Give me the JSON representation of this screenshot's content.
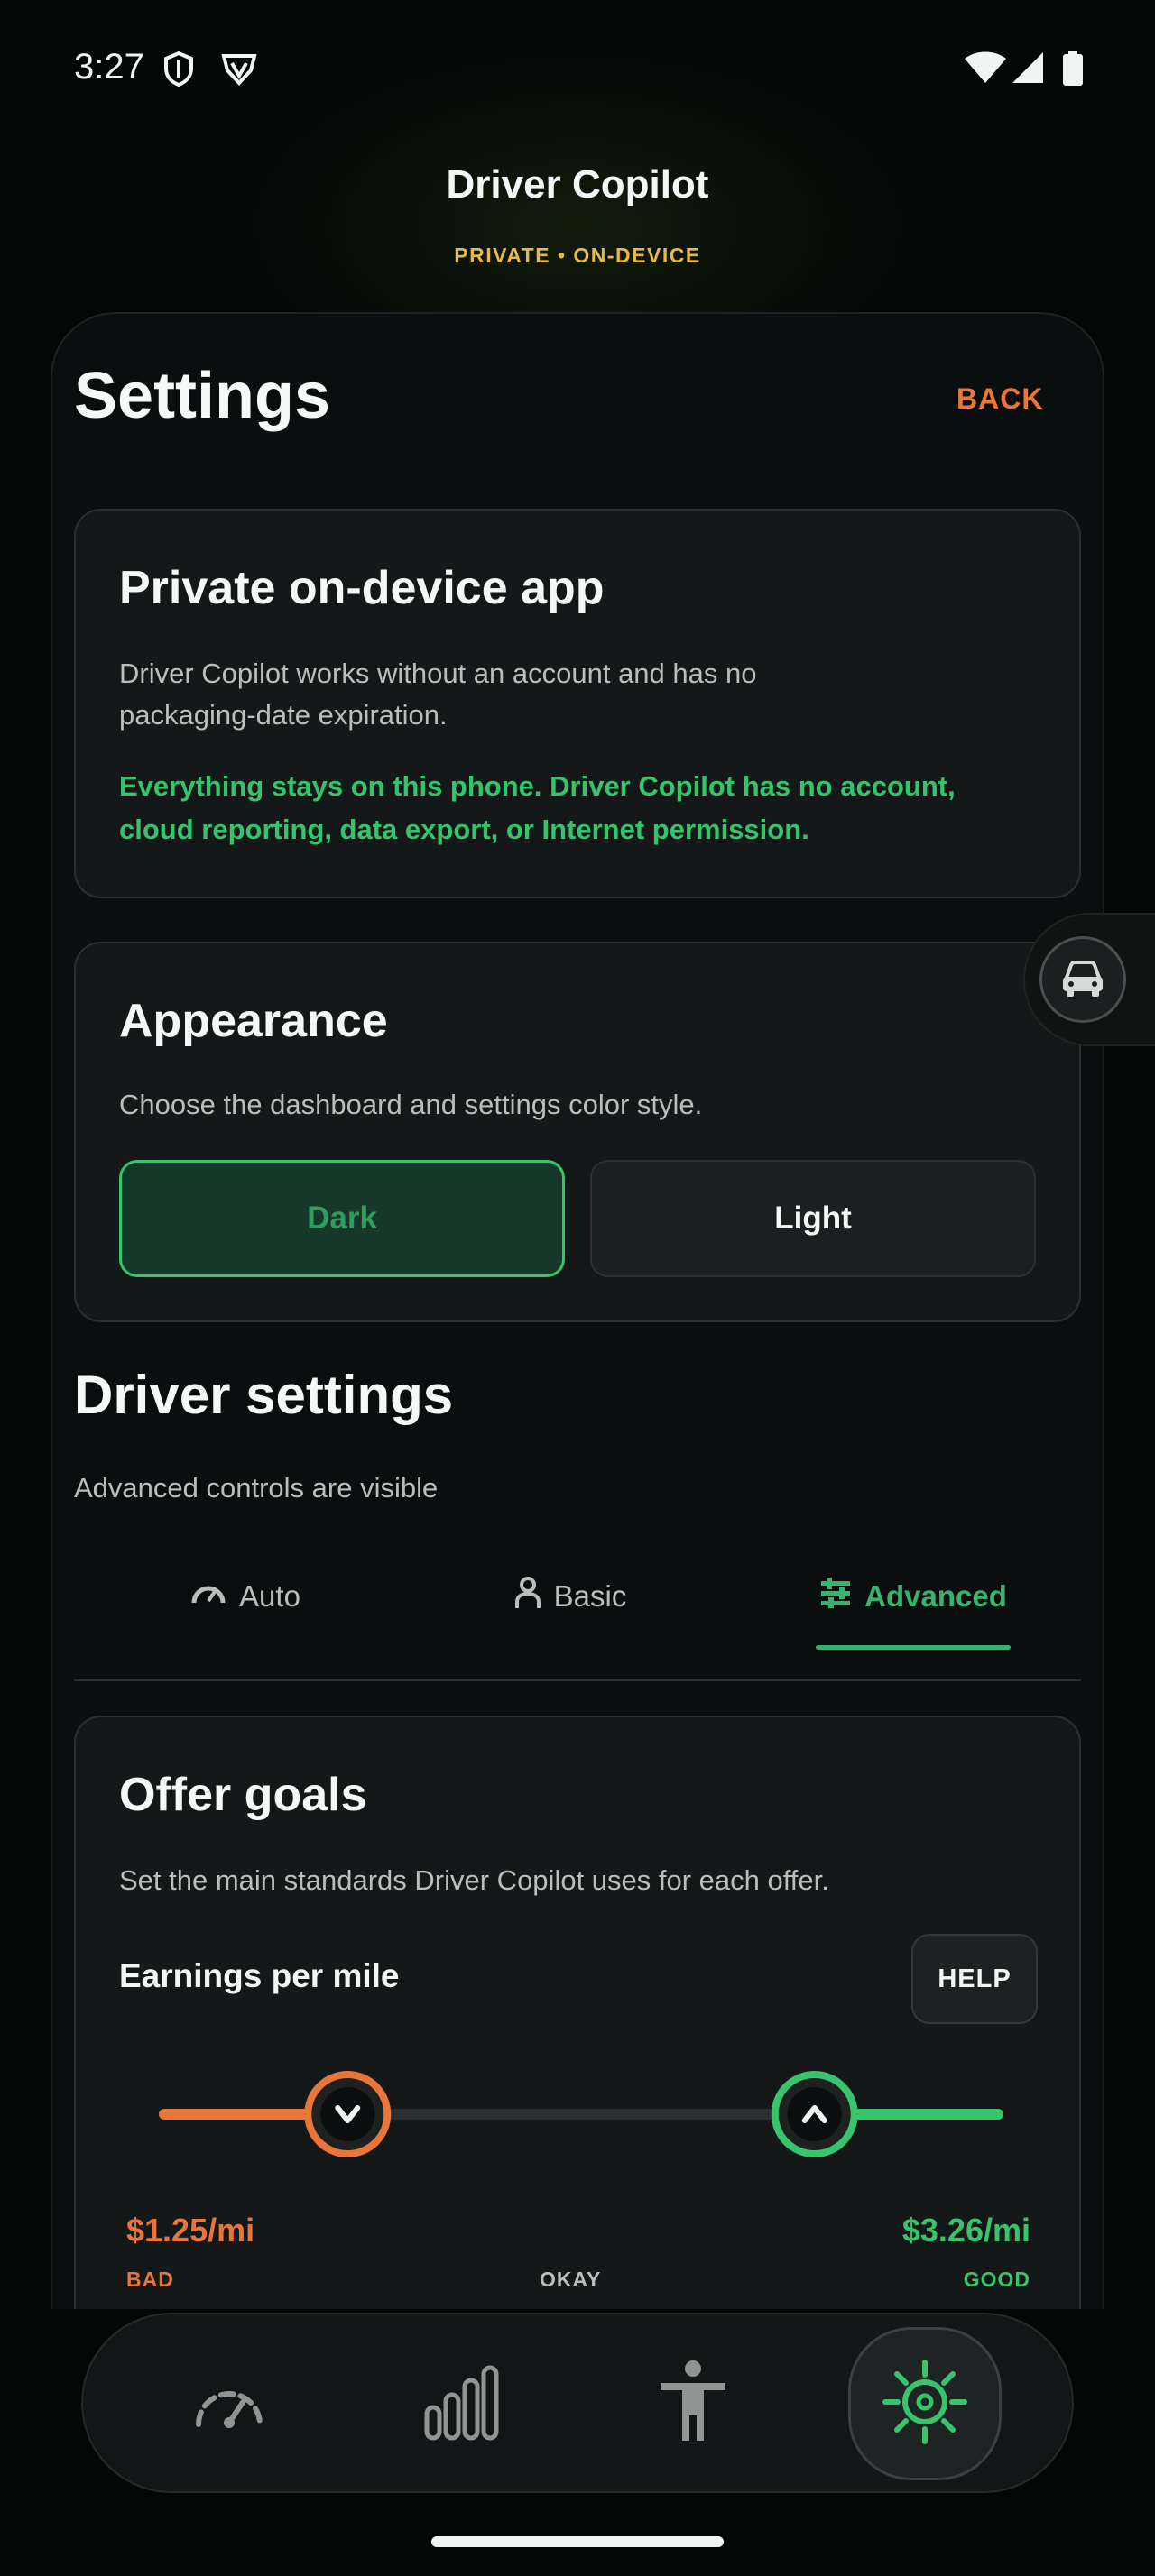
{
  "status_bar": {
    "time": "3:27",
    "left_icons": [
      "shield-icon",
      "vpn-icon"
    ],
    "right_icons": [
      "wifi-icon",
      "signal-icon",
      "battery-icon"
    ]
  },
  "header": {
    "title": "Driver Copilot",
    "subtitle": "PRIVATE • ON-DEVICE"
  },
  "page": {
    "title": "Settings",
    "back_label": "BACK"
  },
  "privacy_card": {
    "title": "Private on-device app",
    "line1": "Driver Copilot works without an account and has no",
    "line2": "packaging-date expiration.",
    "highlight1": "Everything stays on this phone. Driver Copilot has no account,",
    "highlight2": "cloud reporting, data export, or Internet permission."
  },
  "appearance_card": {
    "title": "Appearance",
    "description": "Choose the dashboard and settings color style.",
    "options": [
      "Dark",
      "Light"
    ],
    "selected": "Dark"
  },
  "driver_settings": {
    "title": "Driver settings",
    "subtitle": "Advanced controls are visible",
    "tabs": [
      {
        "label": "Auto",
        "icon": "speedometer-icon"
      },
      {
        "label": "Basic",
        "icon": "person-icon"
      },
      {
        "label": "Advanced",
        "icon": "sliders-icon"
      }
    ],
    "active_tab": "Advanced"
  },
  "offer_goals": {
    "title": "Offer goals",
    "description": "Set the main standards Driver Copilot uses for each offer.",
    "metric_label": "Earnings per mile",
    "help_label": "HELP",
    "bad_value": "$1.25/mi",
    "good_value": "$3.26/mi",
    "bad_label": "BAD",
    "okay_label": "OKAY",
    "good_label": "GOOD",
    "bad_handle_fraction": 0.22,
    "good_handle_fraction": 0.78
  },
  "bottom_nav": {
    "items": [
      "dashboard-icon",
      "stats-icon",
      "accessibility-icon",
      "settings-icon"
    ],
    "active": "settings-icon"
  },
  "colors": {
    "accent_green": "#37c46c",
    "accent_orange": "#e8763a",
    "accent_yellow": "#e8b94a",
    "background": "#050707"
  }
}
